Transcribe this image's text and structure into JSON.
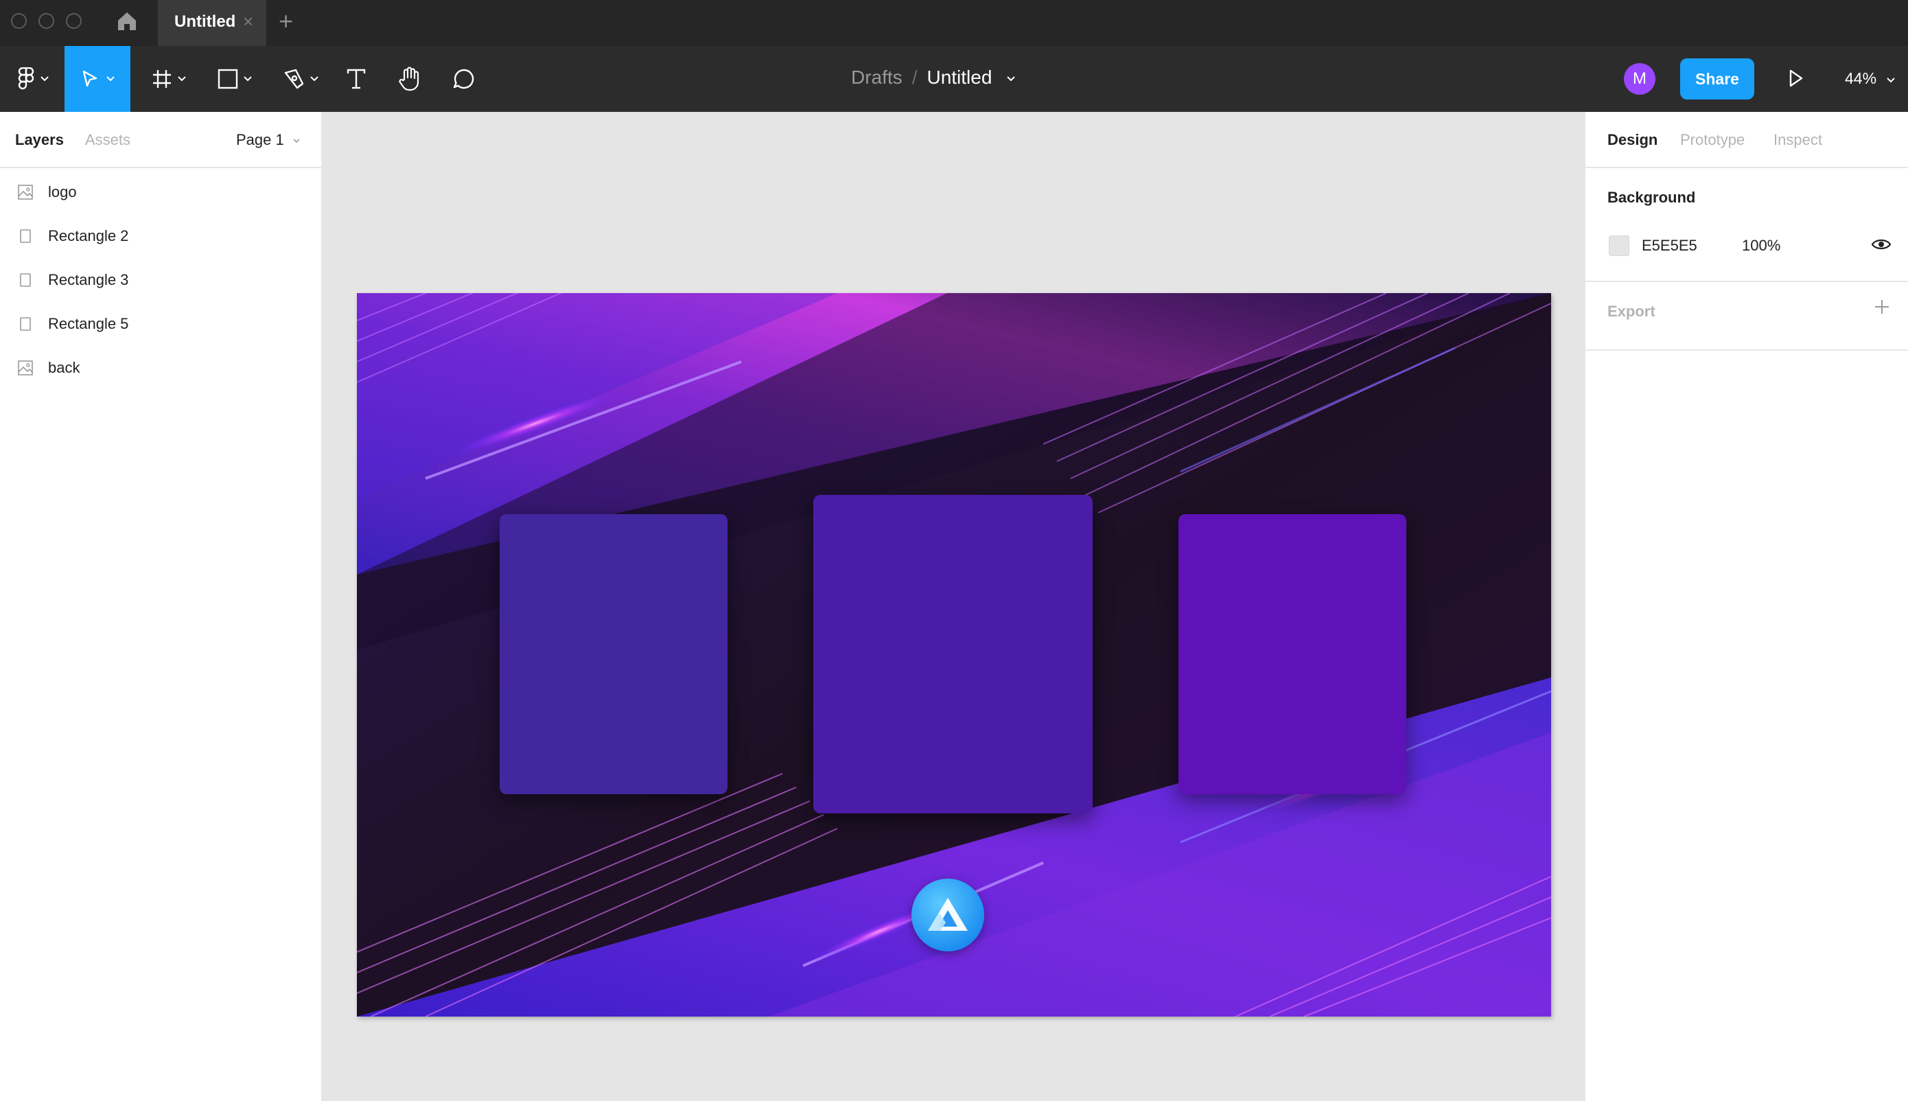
{
  "titlebar": {
    "tab_title": "Untitled",
    "tab_close": "×",
    "new_tab": "+"
  },
  "toolbar": {
    "breadcrumb_parent": "Drafts",
    "breadcrumb_separator": "/",
    "file_name": "Untitled",
    "avatar_initial": "M",
    "share_label": "Share",
    "zoom_level": "44%",
    "tools": [
      "main-menu",
      "move",
      "frame",
      "rectangle",
      "pen",
      "text",
      "hand",
      "comment"
    ]
  },
  "left_panel": {
    "tabs": {
      "layers": "Layers",
      "assets": "Assets"
    },
    "page_select": "Page 1",
    "layers": [
      {
        "name": "logo",
        "icon": "image-icon"
      },
      {
        "name": "Rectangle 2",
        "icon": "rectangle-icon"
      },
      {
        "name": "Rectangle 3",
        "icon": "rectangle-icon"
      },
      {
        "name": "Rectangle 5",
        "icon": "rectangle-icon"
      },
      {
        "name": "back",
        "icon": "image-icon"
      }
    ]
  },
  "right_panel": {
    "tabs": {
      "design": "Design",
      "prototype": "Prototype",
      "inspect": "Inspect"
    },
    "background": {
      "title": "Background",
      "hex": "E5E5E5",
      "opacity": "100%",
      "color": "#e5e5e5"
    },
    "export": {
      "title": "Export"
    }
  },
  "colors": {
    "accent": "#18a0fb",
    "avatar": "#9747ff",
    "rect_left": "#42279e",
    "rect_center": "#4b1ca6",
    "rect_right": "#5e12b7"
  }
}
